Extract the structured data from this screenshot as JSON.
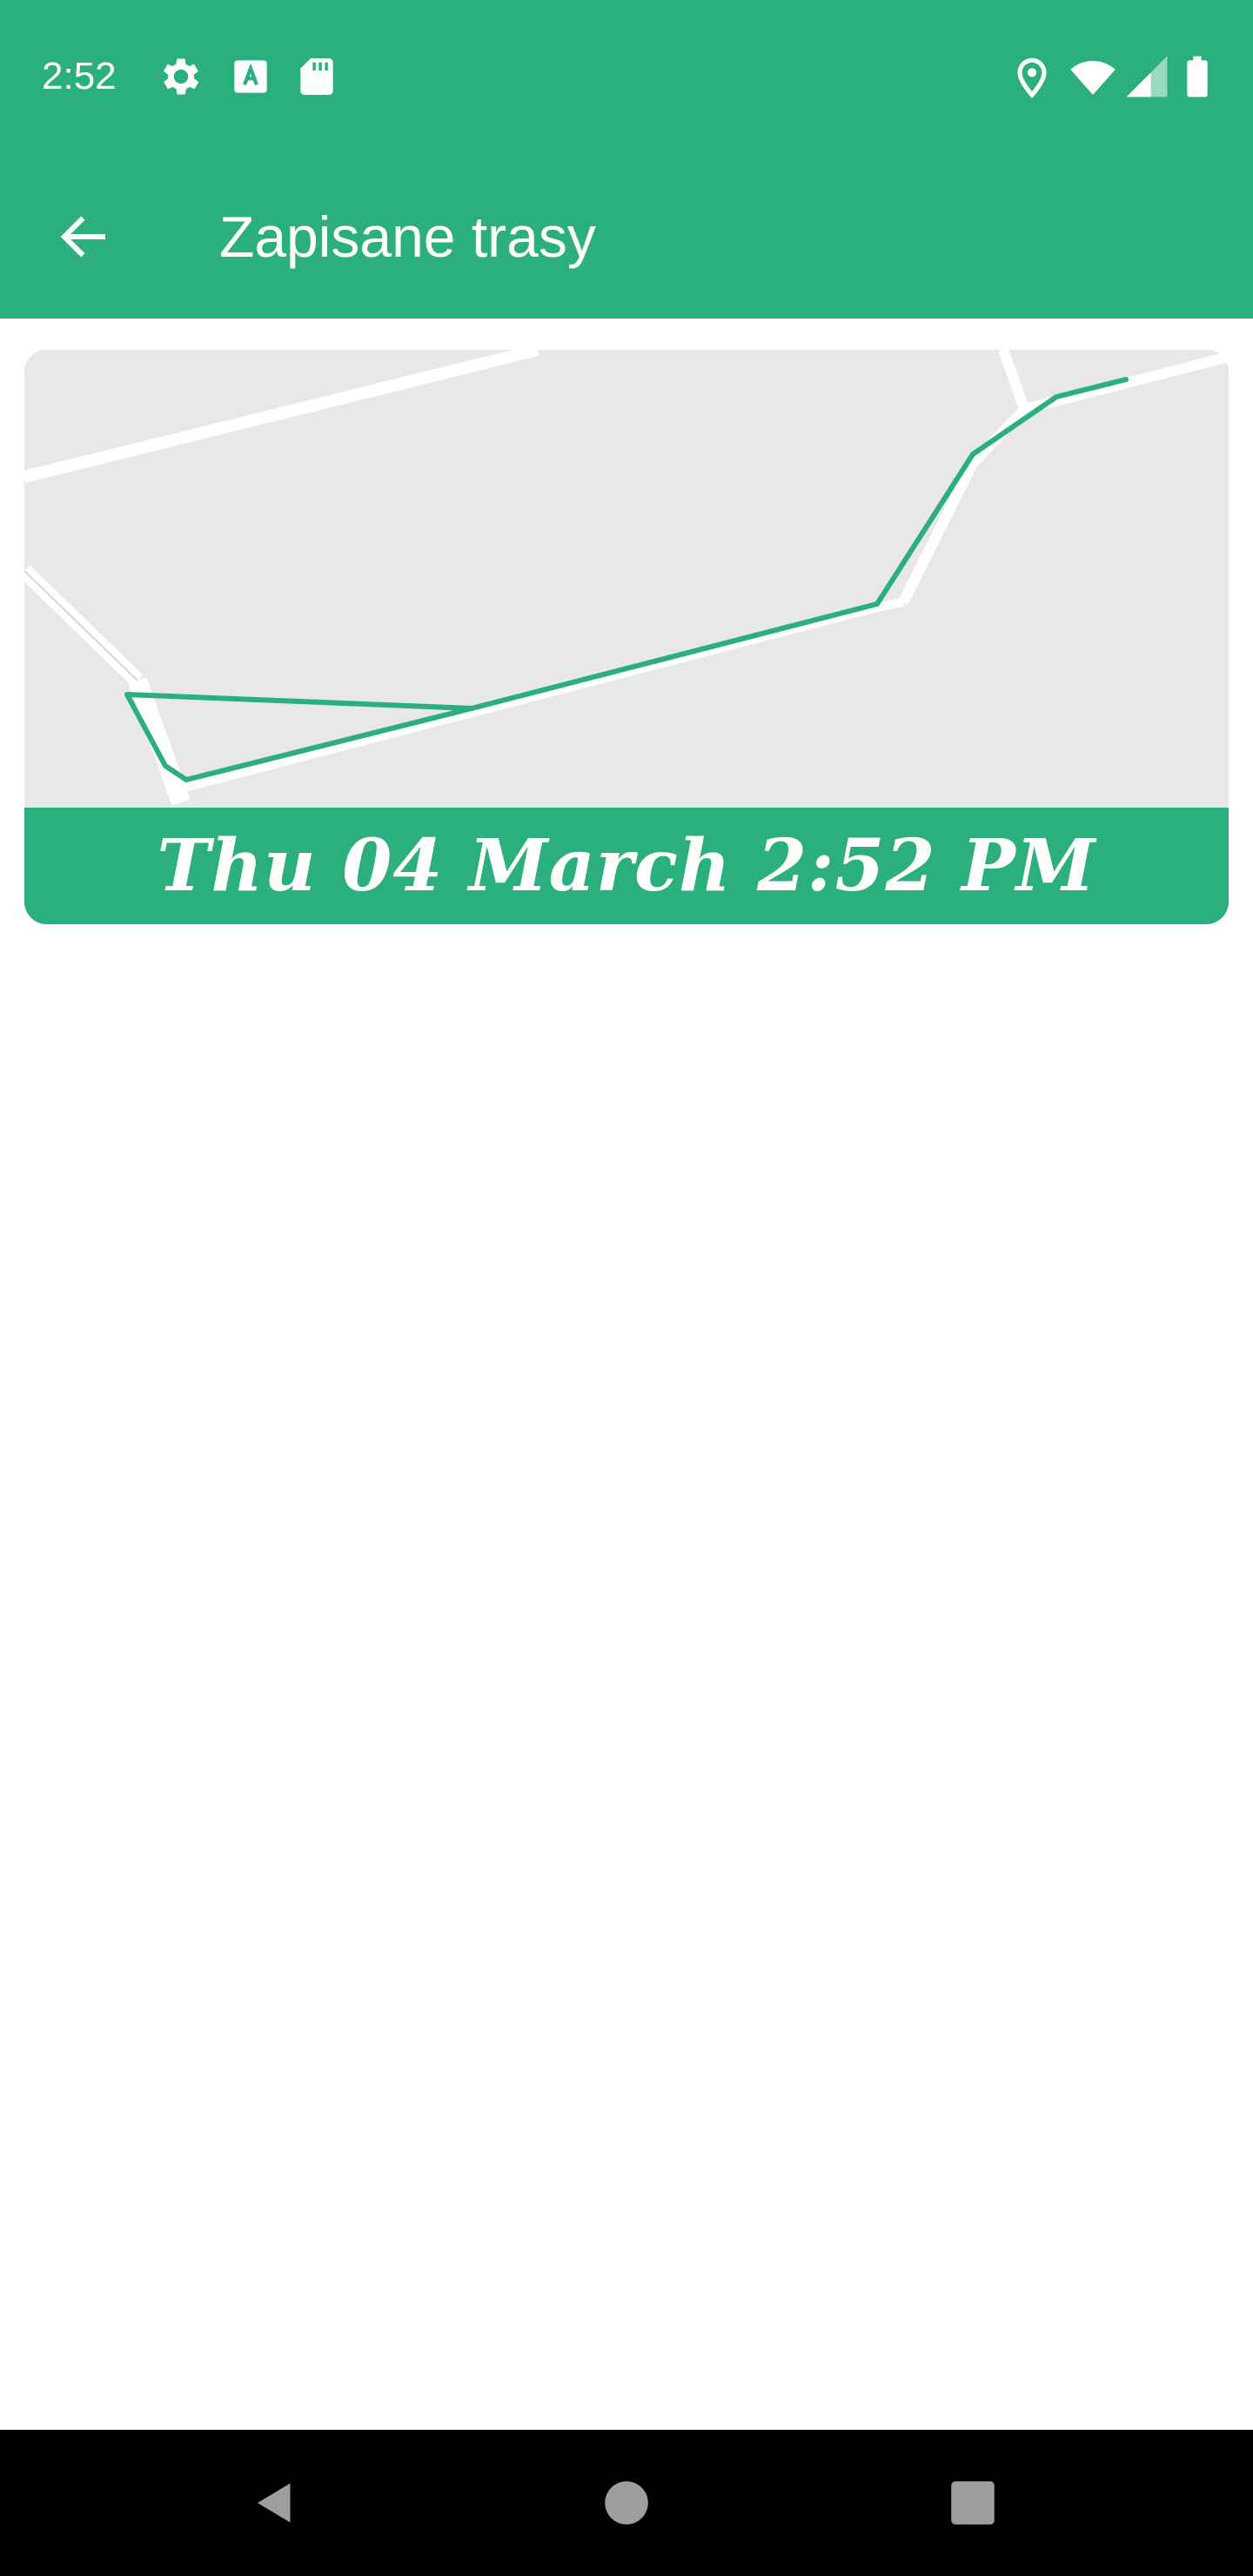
{
  "status_bar": {
    "time": "2:52",
    "left_icons": [
      "gear-icon",
      "keyboard-a-icon",
      "sd-card-icon"
    ],
    "right_icons": [
      "location-pin-icon",
      "wifi-icon",
      "cell-signal-icon",
      "battery-icon"
    ]
  },
  "app_bar": {
    "title": "Zapisane trasy",
    "back_icon": "arrow-left-icon"
  },
  "routes": [
    {
      "date_label": "Thu 04 March 2:52 PM"
    }
  ],
  "colors": {
    "primary": "#2bb07d",
    "map_background": "#e8e8e8",
    "road": "#ffffff"
  },
  "nav_bar": {
    "buttons": [
      "back-triangle-icon",
      "home-circle-icon",
      "recents-square-icon"
    ]
  }
}
